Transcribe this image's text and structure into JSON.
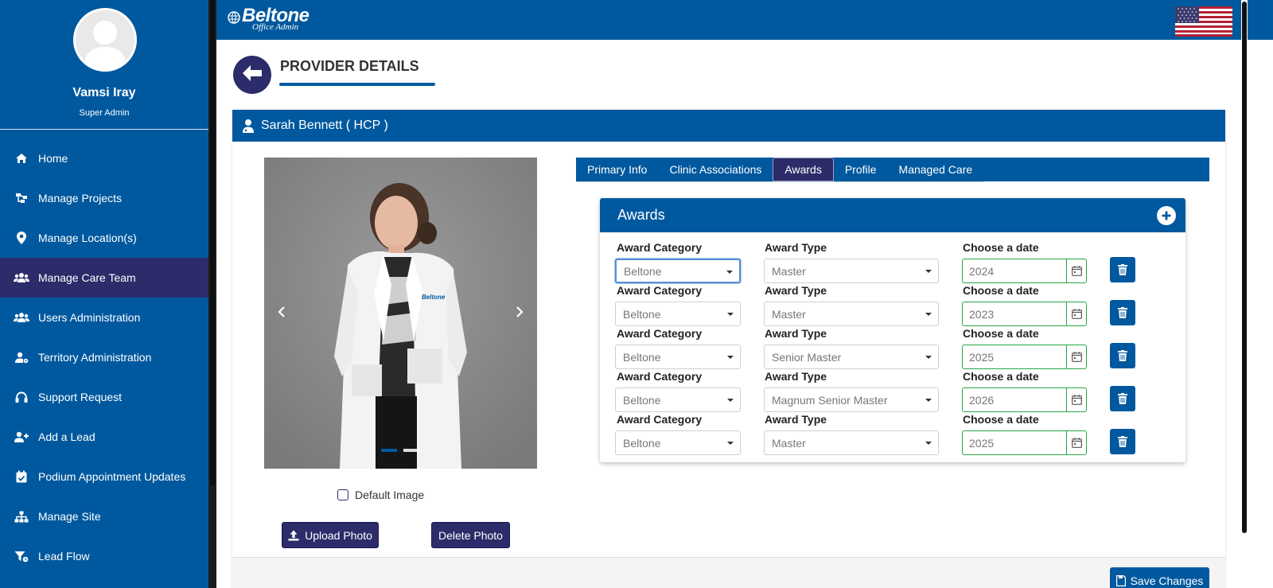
{
  "user": {
    "name": "Vamsi Iray",
    "role": "Super Admin"
  },
  "sidebar": {
    "items": [
      {
        "label": "Home",
        "icon": "home-icon"
      },
      {
        "label": "Manage Projects",
        "icon": "sitemap-icon"
      },
      {
        "label": "Manage Location(s)",
        "icon": "map-marker-icon"
      },
      {
        "label": "Manage Care Team",
        "icon": "users-icon",
        "active": true
      },
      {
        "label": "Users Administration",
        "icon": "users-icon"
      },
      {
        "label": "Territory Administration",
        "icon": "user-gear-icon"
      },
      {
        "label": "Support Request",
        "icon": "headset-icon"
      },
      {
        "label": "Add a Lead",
        "icon": "user-plus-icon"
      },
      {
        "label": "Podium Appointment Updates",
        "icon": "calendar-check-icon"
      },
      {
        "label": "Manage Site",
        "icon": "sitemap-icon"
      },
      {
        "label": "Lead Flow",
        "icon": "filter-icon"
      }
    ]
  },
  "header": {
    "brand": "Beltone",
    "subbrand": "Office Admin",
    "flag": "us-flag-icon"
  },
  "page": {
    "title": "PROVIDER DETAILS"
  },
  "provider": {
    "name": "Sarah Bennett ( HCP )"
  },
  "photo": {
    "default_image_label": "Default Image",
    "upload_label": "Upload Photo",
    "delete_label": "Delete Photo",
    "coat_logo": "Beltone"
  },
  "tabs": [
    {
      "label": "Primary Info"
    },
    {
      "label": "Clinic Associations"
    },
    {
      "label": "Awards",
      "active": true
    },
    {
      "label": "Profile"
    },
    {
      "label": "Managed Care"
    }
  ],
  "awards": {
    "title": "Awards",
    "labels": {
      "category": "Award Category",
      "type": "Award Type",
      "date": "Choose a date"
    },
    "rows": [
      {
        "category": "Beltone",
        "type": "Master",
        "date": "2024"
      },
      {
        "category": "Beltone",
        "type": "Master",
        "date": "2023"
      },
      {
        "category": "Beltone",
        "type": "Senior Master",
        "date": "2025"
      },
      {
        "category": "Beltone",
        "type": "Magnum Senior Master",
        "date": "2026"
      },
      {
        "category": "Beltone",
        "type": "Master",
        "date": "2025"
      }
    ]
  },
  "footer": {
    "save_label": "Save Changes"
  },
  "colors": {
    "primary": "#00599f",
    "dark": "#2c2c6a",
    "valid": "#28a745"
  }
}
